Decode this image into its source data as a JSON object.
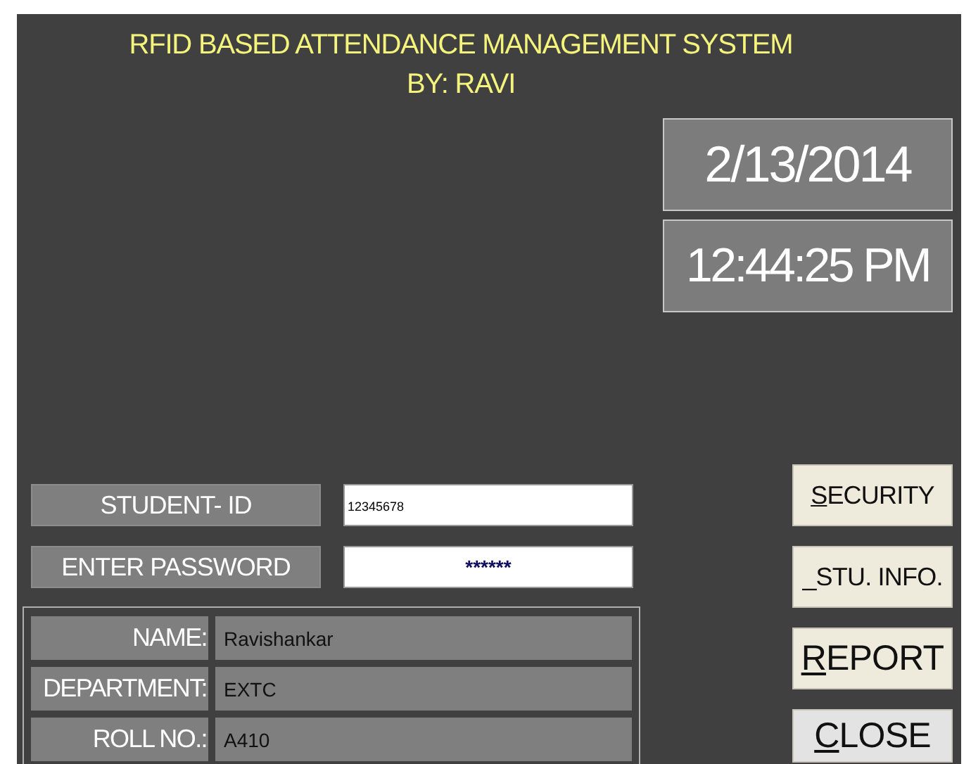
{
  "header": {
    "title": "RFID BASED ATTENDANCE MANAGEMENT SYSTEM",
    "subtitle": "BY: RAVI"
  },
  "clock": {
    "date": "2/13/2014",
    "time": "12:44:25 PM"
  },
  "login": [
    {
      "label": "STUDENT- ID",
      "value": "12345678",
      "kind": "text"
    },
    {
      "label": "ENTER PASSWORD",
      "value": "******",
      "kind": "password"
    }
  ],
  "details": [
    {
      "label": "NAME:",
      "value": "Ravishankar"
    },
    {
      "label": "DEPARTMENT:",
      "value": "EXTC"
    },
    {
      "label": "ROLL NO.:",
      "value": "A410"
    }
  ],
  "buttons": [
    {
      "label": "SECURITY",
      "underline_first": true,
      "focused": false
    },
    {
      "label": "_STU. INFO.",
      "underline_first": false,
      "focused": false
    },
    {
      "label": "REPORT",
      "underline_first": true,
      "focused": false
    },
    {
      "label": "CLOSE",
      "underline_first": true,
      "focused": true
    }
  ]
}
